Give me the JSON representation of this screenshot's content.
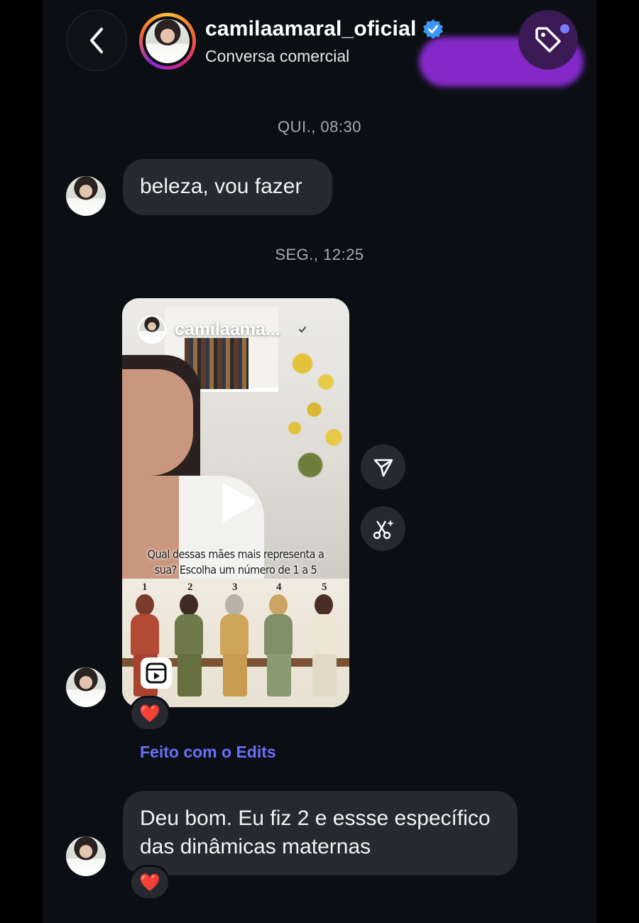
{
  "header": {
    "username": "camilaamaral_oficial",
    "subtitle": "Conversa comercial",
    "verified": true
  },
  "messages": {
    "timestamp_1": "QUI., 08:30",
    "message_1": "beleza, vou fazer",
    "timestamp_2": "SEG., 12:25",
    "reel": {
      "username": "camilaama...",
      "caption": "Qual dessas mães mais representa a sua? Escolha um número de 1 a 5",
      "caption_line_1": "Qual dessas mães mais representa a",
      "caption_line_2": "sua? Escolha um número de 1 a 5",
      "numbers": [
        "1",
        "2",
        "3",
        "4",
        "5"
      ],
      "reaction": "❤️"
    },
    "edits_link": "Feito com o Edits",
    "message_2": "Deu bom. Eu fiz 2 e essse específico das dinâmicas maternas",
    "message_2_reaction": "❤️"
  },
  "colors": {
    "background": "#0b0f14",
    "bubble": "#262a30",
    "accent_link": "#6b6ff7",
    "verified_blue": "#3b97f3",
    "promo_purple": "#8b2bd1"
  },
  "icons": [
    "back-chevron-icon",
    "verified-badge-icon",
    "tag-icon",
    "share-icon",
    "remix-icon",
    "play-icon",
    "reels-icon",
    "heart-icon"
  ]
}
